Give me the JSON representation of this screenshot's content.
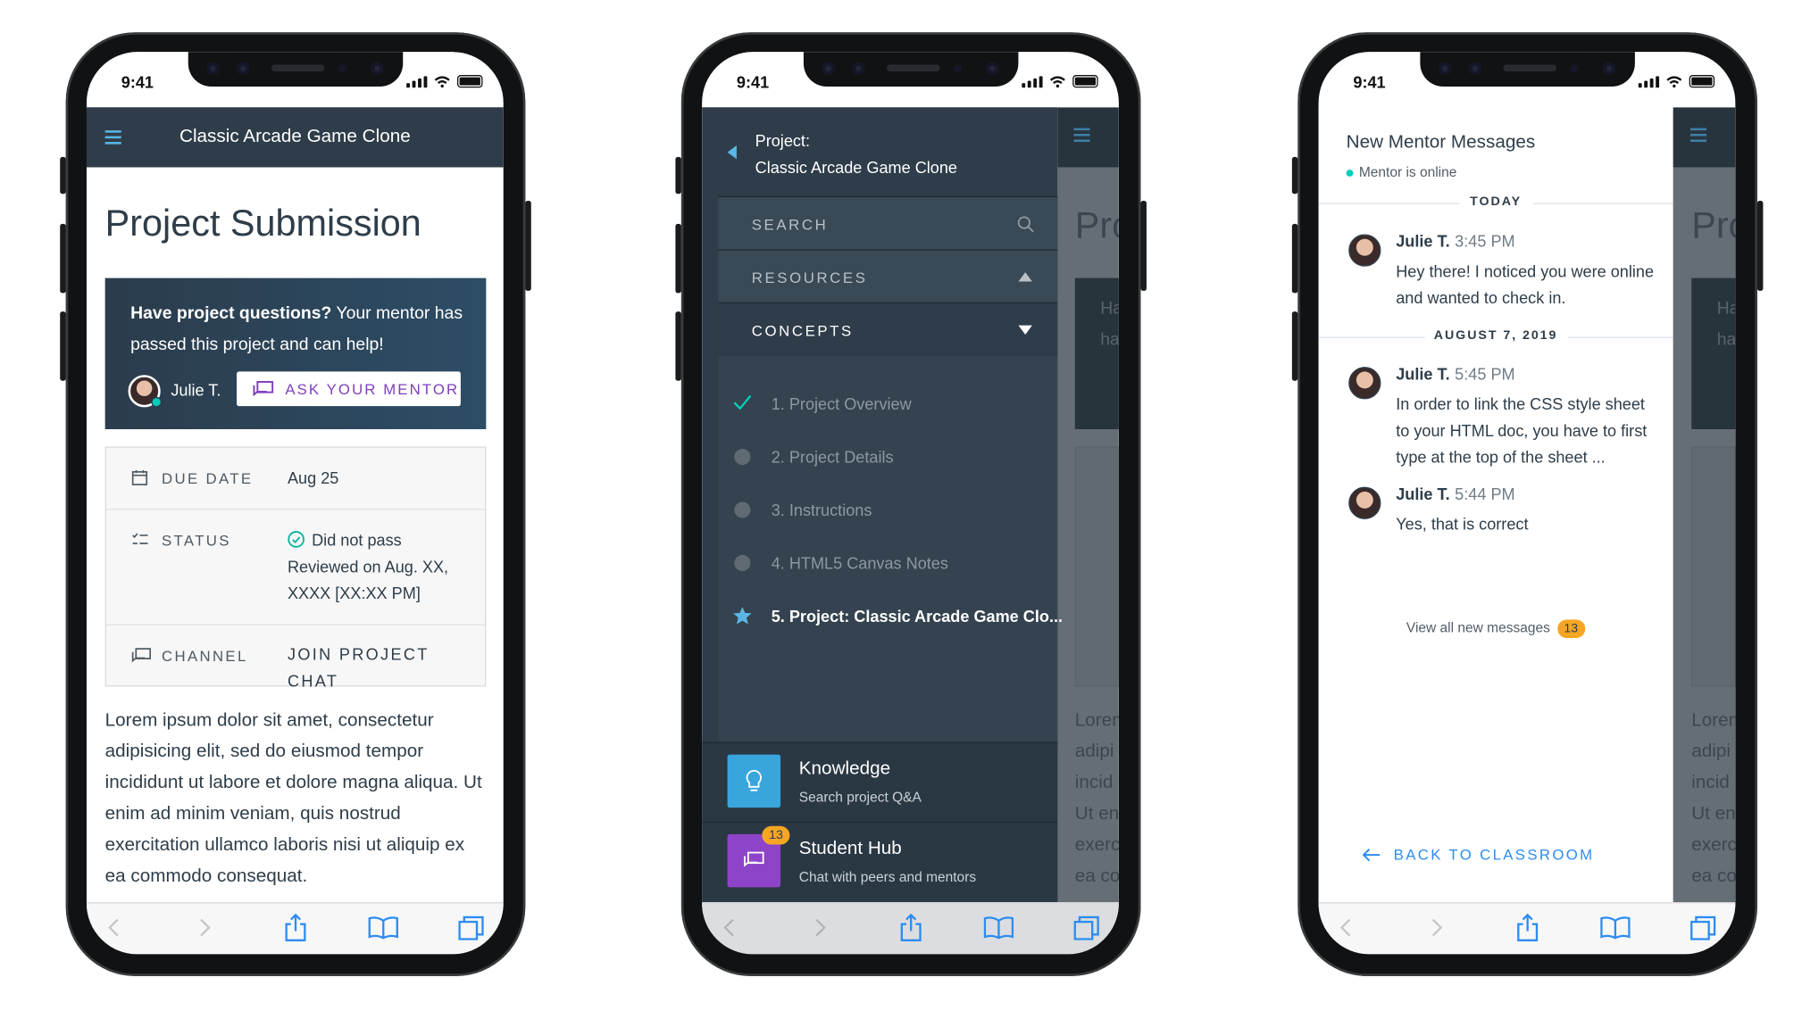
{
  "status_time": "9:41",
  "phone1": {
    "header_title": "Classic Arcade Game Clone",
    "page_title": "Project Submission",
    "mentor_box": {
      "question_bold": "Have project questions?",
      "question_rest": " Your mentor has passed this project and can help!",
      "mentor_name": "Julie T.",
      "ask_button": "ASK YOUR MENTOR"
    },
    "info": {
      "due_label": "DUE DATE",
      "due_value": "Aug 25",
      "status_label": "STATUS",
      "status_value": "Did not pass",
      "status_detail_1": "Reviewed on Aug. XX,",
      "status_detail_2": "XXXX [XX:XX PM]",
      "channel_label": "CHANNEL",
      "channel_link": "JOIN PROJECT CHAT"
    },
    "lorem": "Lorem ipsum dolor sit amet, consectetur adipisicing elit, sed do eiusmod tempor incididunt ut labore et dolore magna aliqua. Ut enim ad minim veniam, quis nostrud exercitation ullamco laboris nisi ut aliquip ex ea commodo consequat."
  },
  "phone2": {
    "project_label_1": "Project:",
    "project_label_2": "Classic Arcade Game Clone",
    "search_label": "SEARCH",
    "resources_label": "RESOURCES",
    "concepts_label": "CONCEPTS",
    "concepts": [
      {
        "label": "1. Project Overview",
        "state": "done"
      },
      {
        "label": "2. Project Details",
        "state": "todo"
      },
      {
        "label": "3. Instructions",
        "state": "todo"
      },
      {
        "label": "4. HTML5 Canvas Notes",
        "state": "todo"
      },
      {
        "label": "5. Project: Classic Arcade Game Clo...",
        "state": "current"
      }
    ],
    "tools": [
      {
        "title": "Knowledge",
        "subtitle": "Search project Q&A",
        "color": "#38a5dd"
      },
      {
        "title": "Student Hub",
        "subtitle": "Chat with peers and mentors",
        "color": "#8e44c9",
        "badge": "13"
      }
    ],
    "peek_title": "Pro",
    "peek_lorem": [
      "Lorem",
      "adipi",
      "incid",
      "Ut en",
      "exerc",
      "ea co"
    ],
    "peek_box": [
      "Ha",
      "ha"
    ]
  },
  "phone3": {
    "heading": "New Mentor Messages",
    "online_text": "Mentor is online",
    "day1": "TODAY",
    "day2": "AUGUST 7, 2019",
    "messages": [
      {
        "name": "Julie T.",
        "time": "3:45 PM",
        "body": "Hey there! I noticed you were online and wanted to check in."
      },
      {
        "name": "Julie T.",
        "time": "5:45 PM",
        "body": "In order to link the CSS style sheet to your HTML doc, you have to first type at the top of the sheet ..."
      },
      {
        "name": "Julie T.",
        "time": "5:44 PM",
        "body": "Yes, that is correct"
      }
    ],
    "view_all": "View all new messages",
    "view_all_badge": "13",
    "back_link": "BACK TO CLASSROOM",
    "peek_title": "Pro"
  },
  "colors": {
    "accent_blue": "#2d8cf0",
    "purple": "#7f3fbf",
    "navy": "#2e3d49",
    "badge_orange": "#f5a623",
    "online_green": "#02ccba"
  }
}
